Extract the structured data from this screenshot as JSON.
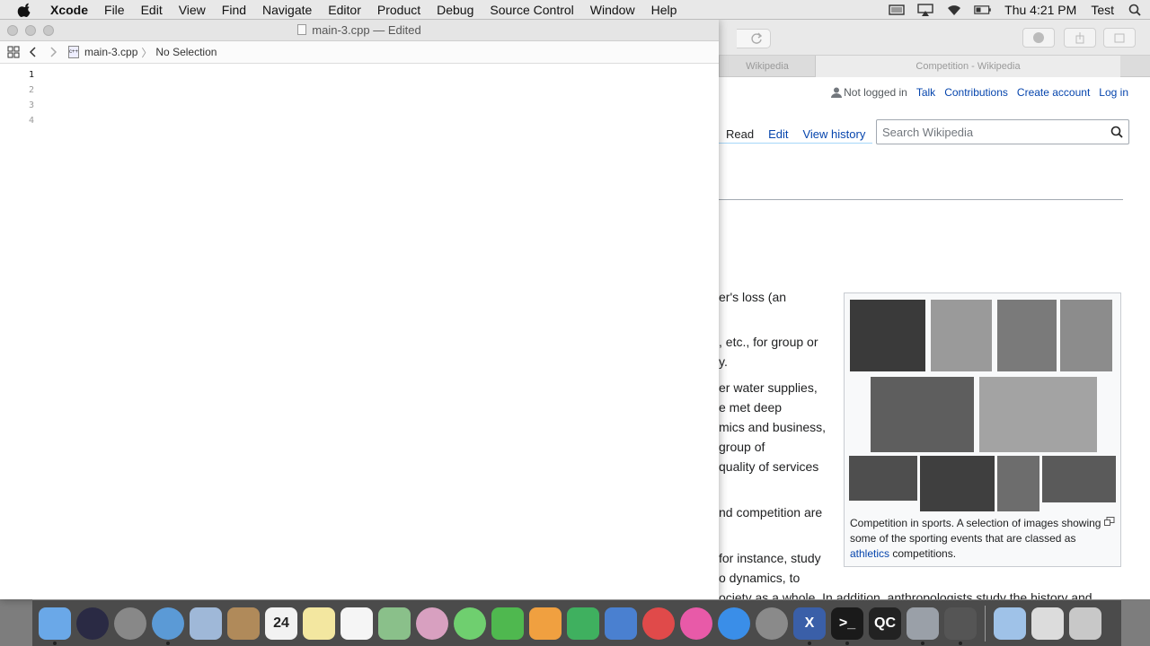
{
  "menubar": {
    "app_name": "Xcode",
    "items": [
      "File",
      "Edit",
      "View",
      "Find",
      "Navigate",
      "Editor",
      "Product",
      "Debug",
      "Source Control",
      "Window",
      "Help"
    ],
    "clock": "Thu 4:21 PM",
    "user": "Test",
    "status_icons": [
      "display-icon",
      "airplay-icon",
      "wifi-icon",
      "battery-icon",
      "spotlight-icon"
    ]
  },
  "xcode": {
    "window_title": "main-3.cpp — Edited",
    "jumpbar": {
      "file": "main-3.cpp",
      "selection": "No Selection"
    },
    "line_numbers": [
      "1",
      "2",
      "3",
      "4"
    ],
    "current_line": "1"
  },
  "browser": {
    "tabs": [
      "Wikipedia",
      "Competition - Wikipedia"
    ],
    "personal": {
      "not_logged_in": "Not logged in",
      "talk": "Talk",
      "contributions": "Contributions",
      "create_account": "Create account",
      "login": "Log in"
    },
    "page_tabs": [
      "Read",
      "Edit",
      "View history"
    ],
    "search_placeholder": "Search Wikipedia",
    "text_lines": [
      "er's loss (an",
      ", etc., for group or",
      "y.",
      "er water supplies,",
      "e met deep",
      "mics and business,",
      "group of",
      "quality of services",
      "nd competition are",
      "for instance, study",
      "o dynamics, to",
      "ociety as a whole. In addition, anthropologists study the history and"
    ],
    "caption": {
      "before": "Competition in sports. A selection of images showing some of the sporting events that are classed as ",
      "link": "athletics",
      "after": " competitions."
    }
  },
  "dock": {
    "apps": [
      "finder-icon",
      "siri-icon",
      "launchpad-icon",
      "safari-icon",
      "mail-icon",
      "contacts-icon",
      "calendar-icon",
      "notes-icon",
      "reminders-icon",
      "maps-icon",
      "photos-icon",
      "messages-icon",
      "facetime-icon",
      "pages-icon",
      "numbers-icon",
      "keynote-icon",
      "news-icon",
      "itunes-icon",
      "app-store-icon",
      "system-preferences-icon"
    ],
    "calendar_day": "24",
    "running": [
      "xcode-icon",
      "terminal-icon",
      "quartz-composer-icon",
      "instruments-icon",
      "claquette-icon"
    ],
    "running_labels": {
      "quartz": "QC"
    },
    "trailing": [
      "downloads-folder-icon",
      "documents-folder-icon",
      "trash-icon"
    ]
  }
}
